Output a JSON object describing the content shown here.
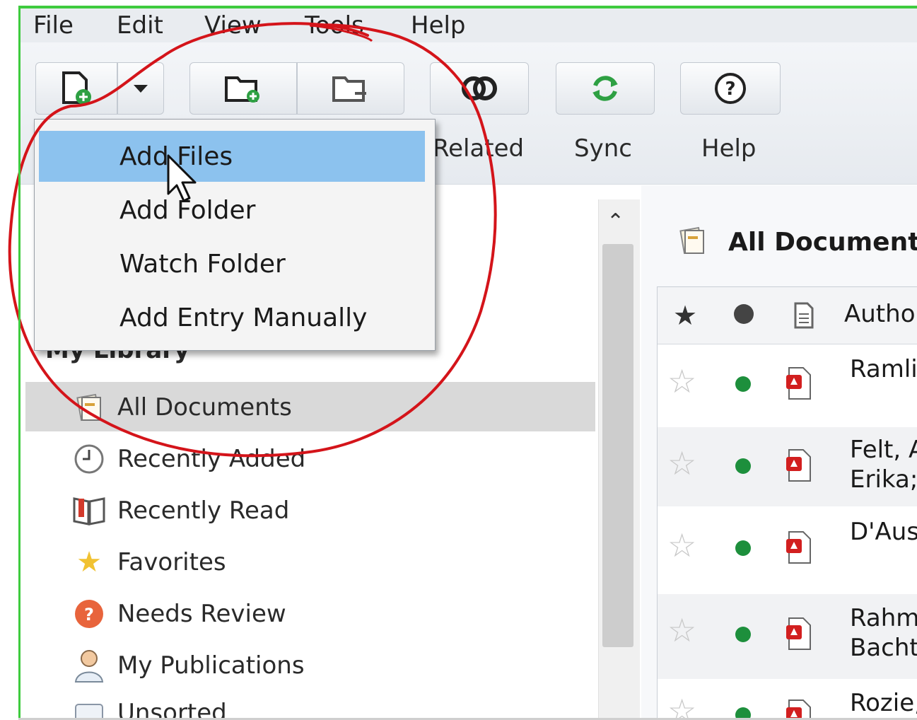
{
  "menubar": {
    "items": [
      "File",
      "Edit",
      "View",
      "Tools",
      "Help"
    ]
  },
  "toolbar": {
    "labels": {
      "related": "Related",
      "sync": "Sync",
      "help": "Help"
    }
  },
  "dropdown": {
    "items": [
      "Add Files",
      "Add Folder",
      "Watch Folder",
      "Add Entry Manually"
    ]
  },
  "sidebar": {
    "header": "My Library",
    "items": [
      {
        "label": "All Documents",
        "icon": "all-documents-icon"
      },
      {
        "label": "Recently Added",
        "icon": "clock-icon"
      },
      {
        "label": "Recently Read",
        "icon": "book-icon"
      },
      {
        "label": "Favorites",
        "icon": "star-icon"
      },
      {
        "label": "Needs Review",
        "icon": "question-icon"
      },
      {
        "label": "My Publications",
        "icon": "person-icon"
      },
      {
        "label": "Unsorted",
        "icon": "unsorted-icon"
      }
    ]
  },
  "main": {
    "title": "All Documents",
    "columns": {
      "author": "Autho"
    },
    "rows": [
      {
        "author": [
          "Ramli,"
        ]
      },
      {
        "author": [
          "Felt, A",
          "Erika;"
        ]
      },
      {
        "author": [
          "D'Aus"
        ]
      },
      {
        "author": [
          "Rahm",
          "Bacht"
        ]
      },
      {
        "author": [
          "Rozie,"
        ]
      }
    ]
  },
  "colors": {
    "highlight": "#8cc2ee",
    "selection": "#d9d9d9",
    "annotation": "#d4141a",
    "read_dot": "#1d8f3c",
    "frame": "#3ecb3e"
  }
}
